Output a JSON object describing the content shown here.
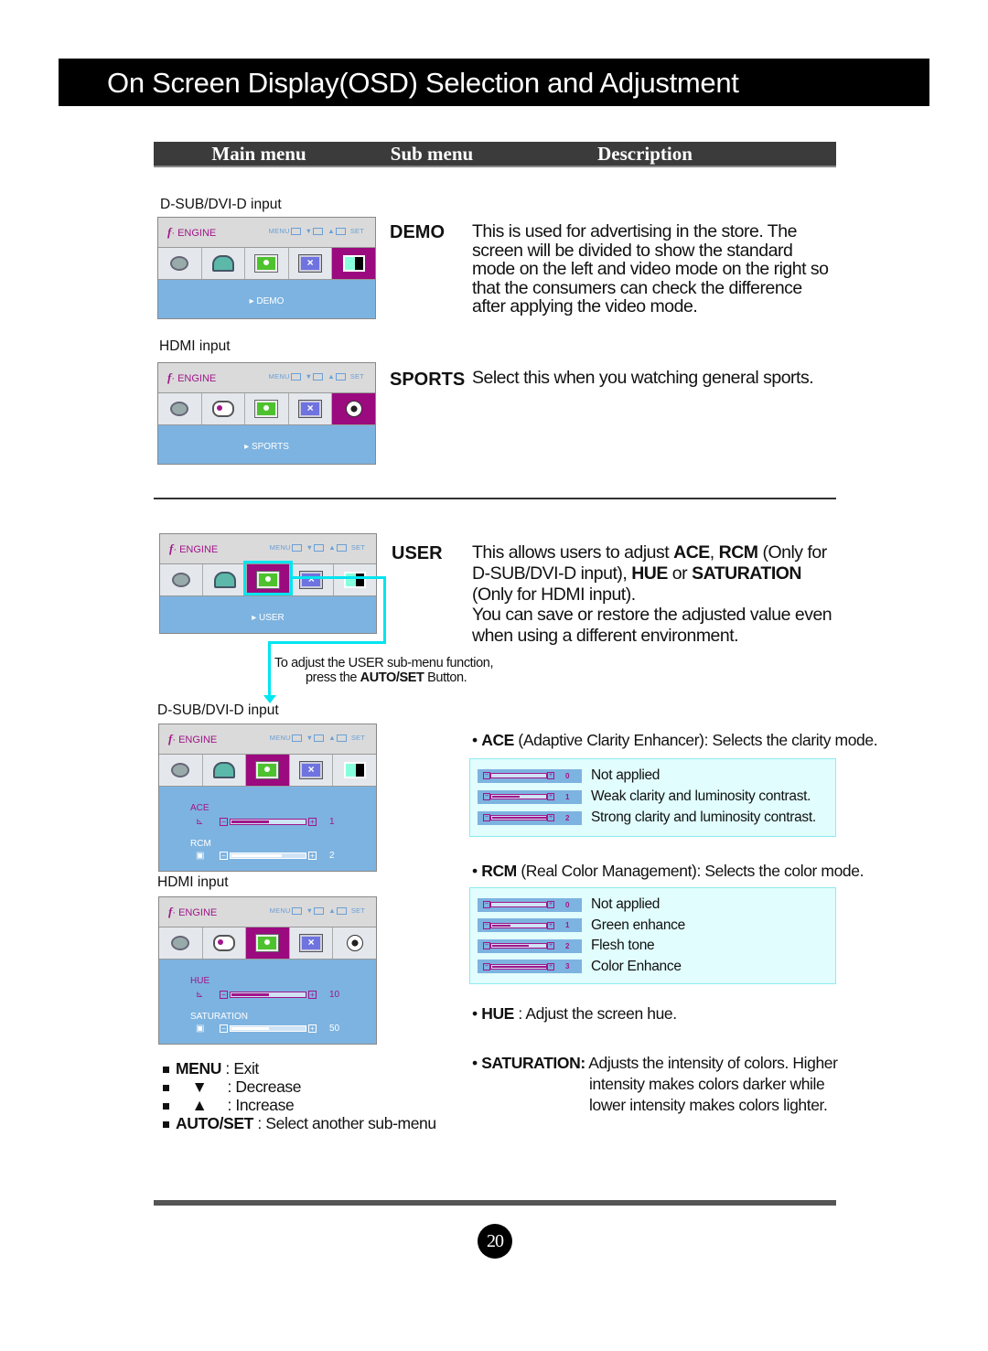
{
  "title": "On Screen Display(OSD) Selection and Adjustment",
  "columns": {
    "main": "Main menu",
    "sub": "Sub menu",
    "description": "Description"
  },
  "osd_common": {
    "engine": "ENGINE",
    "menu": "MENU",
    "set": "SET"
  },
  "demo_section": {
    "input_label": "D-SUB/DVI-D input",
    "menu_label": "DEMO",
    "key": "DEMO",
    "description": "This is used for advertising in the store. The screen will be divided to show the standard mode on the left and video mode on the right so that the consumers can check the difference after applying the video mode."
  },
  "sports_section": {
    "input_label": "HDMI input",
    "menu_label": "SPORTS",
    "key": "SPORTS",
    "description": "Select this when you watching general sports."
  },
  "user_section": {
    "menu_label": "USER",
    "key": "USER",
    "desc_1": "This allows users to adjust ",
    "ace": "ACE",
    "comma": ", ",
    "rcm": "RCM",
    "desc_2": " (Only for D-SUB/DVI-D input), ",
    "hue": "HUE",
    "or": " or ",
    "saturation": "SATURATION",
    "desc_3": " (Only for HDMI input).",
    "desc_4": "You can save or restore the adjusted value even when using a different environment.",
    "note_1": "To adjust the USER sub-menu function,",
    "note_2a": "press the ",
    "note_2b": "AUTO/SET",
    "note_2c": " Button."
  },
  "dsub_panel": {
    "input_label": "D-SUB/DVI-D input",
    "sliders": [
      {
        "name": "ACE",
        "value": "1",
        "fill": 0.5,
        "fill_color": "#a0168a"
      },
      {
        "name": "RCM",
        "value": "2",
        "fill": 0.67,
        "fill_color": "#ffffff"
      }
    ]
  },
  "hdmi_panel": {
    "input_label": "HDMI input",
    "sliders": [
      {
        "name": "HUE",
        "value": "10",
        "fill": 0.5,
        "fill_color": "#a0168a"
      },
      {
        "name": "SATURATION",
        "value": "50",
        "fill": 0.5,
        "fill_color": "#ffffff"
      }
    ]
  },
  "ace_info": {
    "key": "ACE",
    "text": " (Adaptive Clarity Enhancer): Selects the clarity mode.",
    "rows": [
      {
        "value": "0",
        "fill": 0,
        "label": "Not applied"
      },
      {
        "value": "1",
        "fill": 0.5,
        "label": "Weak clarity and luminosity contrast."
      },
      {
        "value": "2",
        "fill": 1,
        "label": "Strong clarity and luminosity contrast."
      }
    ]
  },
  "rcm_info": {
    "key": "RCM",
    "text": " (Real Color Management): Selects the color mode.",
    "rows": [
      {
        "value": "0",
        "fill": 0,
        "label": "Not applied"
      },
      {
        "value": "1",
        "fill": 0.33,
        "label": "Green enhance"
      },
      {
        "value": "2",
        "fill": 0.67,
        "label": "Flesh tone"
      },
      {
        "value": "3",
        "fill": 1,
        "label": "Color Enhance"
      }
    ]
  },
  "hue_info": {
    "key": "HUE",
    "text": " : Adjust the screen hue."
  },
  "sat_info": {
    "key": "SATURATION:",
    "line1": " Adjusts the intensity of colors. Higher",
    "line2": "intensity makes colors darker while",
    "line3": "lower intensity makes colors lighter."
  },
  "legend": [
    {
      "key": "MENU",
      "text": " : Exit"
    },
    {
      "key": "▼",
      "text": " : Decrease"
    },
    {
      "key": "▲",
      "text": " : Increase"
    },
    {
      "key": "AUTO/SET",
      "text": " : Select another sub-menu"
    }
  ],
  "page_number": "20",
  "colors": {
    "accent": "#a0168a",
    "osd_blue": "#7db3e0",
    "highlight": "#00e5f0"
  }
}
